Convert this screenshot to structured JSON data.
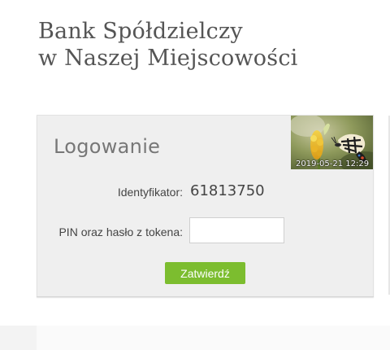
{
  "header": {
    "bank_name_line1": "Bank Spółdzielczy",
    "bank_name_line2": "w Naszej Miejscowości"
  },
  "login": {
    "heading": "Logowanie",
    "security_image": {
      "icon": "butterfly-on-flower-image",
      "date": "2019-05-21 12:29"
    },
    "identifier_label": "Identyfikator:",
    "identifier_value": "61813750",
    "pin_label": "PIN oraz hasło z tokena:",
    "pin_value": "",
    "submit_label": "Zatwierdź"
  },
  "colors": {
    "panel_background": "#efefef",
    "button_green": "#7cbd2f",
    "title_text": "#555555",
    "heading_text": "#777777"
  }
}
